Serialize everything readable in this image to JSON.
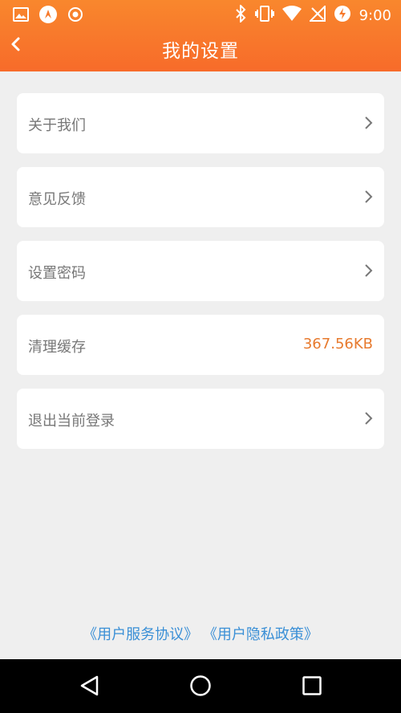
{
  "status_bar": {
    "time": "9:00",
    "icons_left": [
      "image-icon",
      "app-icon",
      "record-icon"
    ],
    "icons_right": [
      "bluetooth-icon",
      "vibrate-icon",
      "wifi-icon",
      "no-signal-icon",
      "battery-charging-icon"
    ]
  },
  "header": {
    "title": "我的设置",
    "back_icon": "chevron-left-icon"
  },
  "settings": {
    "items": [
      {
        "label": "关于我们",
        "name": "about-us"
      },
      {
        "label": "意见反馈",
        "name": "feedback"
      },
      {
        "label": "设置密码",
        "name": "set-password"
      },
      {
        "label": "清理缓存",
        "name": "clear-cache",
        "value": "367.56KB"
      },
      {
        "label": "退出当前登录",
        "name": "logout"
      }
    ]
  },
  "footer": {
    "agreement": "《用户服务协议》",
    "privacy": "《用户隐私政策》"
  },
  "colors": {
    "header_gradient_top": "#f9872d",
    "header_gradient_bottom": "#f76b2a",
    "accent": "#e77a2e",
    "link": "#3a8fd6",
    "background": "#efefef"
  }
}
